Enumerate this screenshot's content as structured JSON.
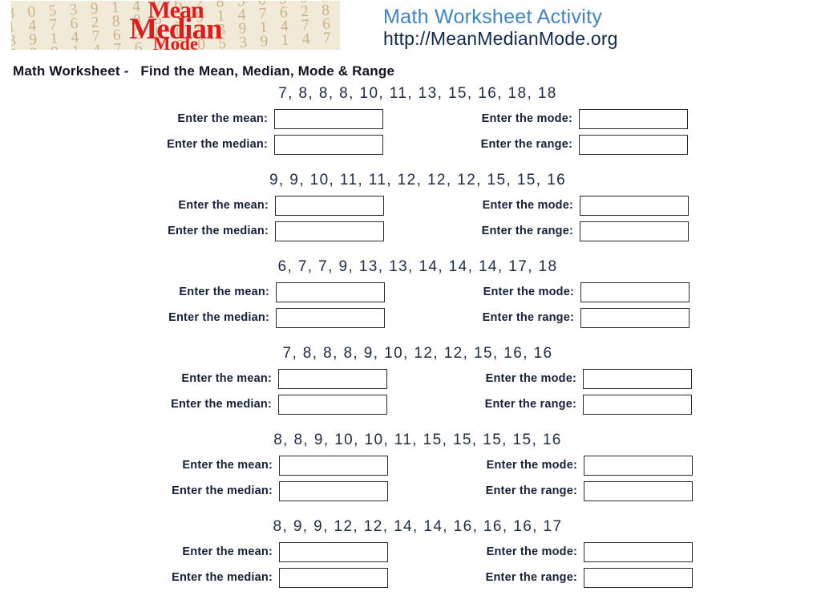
{
  "header": {
    "logo": {
      "line1": "Mean",
      "line2": "Median",
      "line3": "Mode",
      "texture_digits": "2 8 0 5 3 9 1 4 7 6 2 8 5 0 3 9 1 7 4 6 2 8 0 5 3 9\n9 1 4 7 6 2 8 0 5 3 9 1 4 7 6 2 8 0 5 3 9 1 4 7 6 2\n5 3 9 1 4 7 6 2 8 0 5 3 9 1 4 7 6 2 8 0 5 3 9 1 4 7\n0 5 3 9 1 4 7 6 2 8 0 5 3 9 1 4 7 6 2 8 0 5 3 9 1 4\n7 6 2 8 0 5 3 9 1 4 7 6 2 8 0 5 3 9 1 4 7 6 2 8 0 5",
      "brand_color": "#e01b1b",
      "background_color": "#f2ead9"
    },
    "site_title": "Math Worksheet Activity",
    "site_url": "http://MeanMedianMode.org",
    "title_color": "#3d85c6",
    "url_color": "#10284a"
  },
  "worksheet_title": "Math Worksheet -   Find the Mean, Median, Mode & Range",
  "labels": {
    "mean": "Enter the mean:",
    "median": "Enter the median:",
    "mode": "Enter the mode:",
    "range": "Enter the range:"
  },
  "problems": [
    {
      "sequence": "7, 8, 8, 8, 10, 11, 13, 15, 16, 18, 18",
      "values": [
        7,
        8,
        8,
        8,
        10,
        11,
        13,
        15,
        16,
        18,
        18
      ],
      "answers": {
        "mean": "",
        "median": "",
        "mode": "",
        "range": ""
      }
    },
    {
      "sequence": "9, 9, 10, 11, 11, 12, 12, 12, 15, 15, 16",
      "values": [
        9,
        9,
        10,
        11,
        11,
        12,
        12,
        12,
        15,
        15,
        16
      ],
      "answers": {
        "mean": "",
        "median": "",
        "mode": "",
        "range": ""
      }
    },
    {
      "sequence": "6, 7, 7, 9, 13, 13, 14, 14, 14, 17, 18",
      "values": [
        6,
        7,
        7,
        9,
        13,
        13,
        14,
        14,
        14,
        17,
        18
      ],
      "answers": {
        "mean": "",
        "median": "",
        "mode": "",
        "range": ""
      }
    },
    {
      "sequence": "7, 8, 8, 8, 9, 10, 12, 12, 15, 16, 16",
      "values": [
        7,
        8,
        8,
        8,
        9,
        10,
        12,
        12,
        15,
        16,
        16
      ],
      "answers": {
        "mean": "",
        "median": "",
        "mode": "",
        "range": ""
      }
    },
    {
      "sequence": "8, 8, 9, 10, 10, 11, 15, 15, 15, 15, 16",
      "values": [
        8,
        8,
        9,
        10,
        10,
        11,
        15,
        15,
        15,
        15,
        16
      ],
      "answers": {
        "mean": "",
        "median": "",
        "mode": "",
        "range": ""
      }
    },
    {
      "sequence": "8, 9, 9, 12, 12, 14, 14, 16, 16, 16, 17",
      "values": [
        8,
        9,
        9,
        12,
        12,
        14,
        14,
        16,
        16,
        16,
        17
      ],
      "answers": {
        "mean": "",
        "median": "",
        "mode": "",
        "range": ""
      }
    }
  ]
}
